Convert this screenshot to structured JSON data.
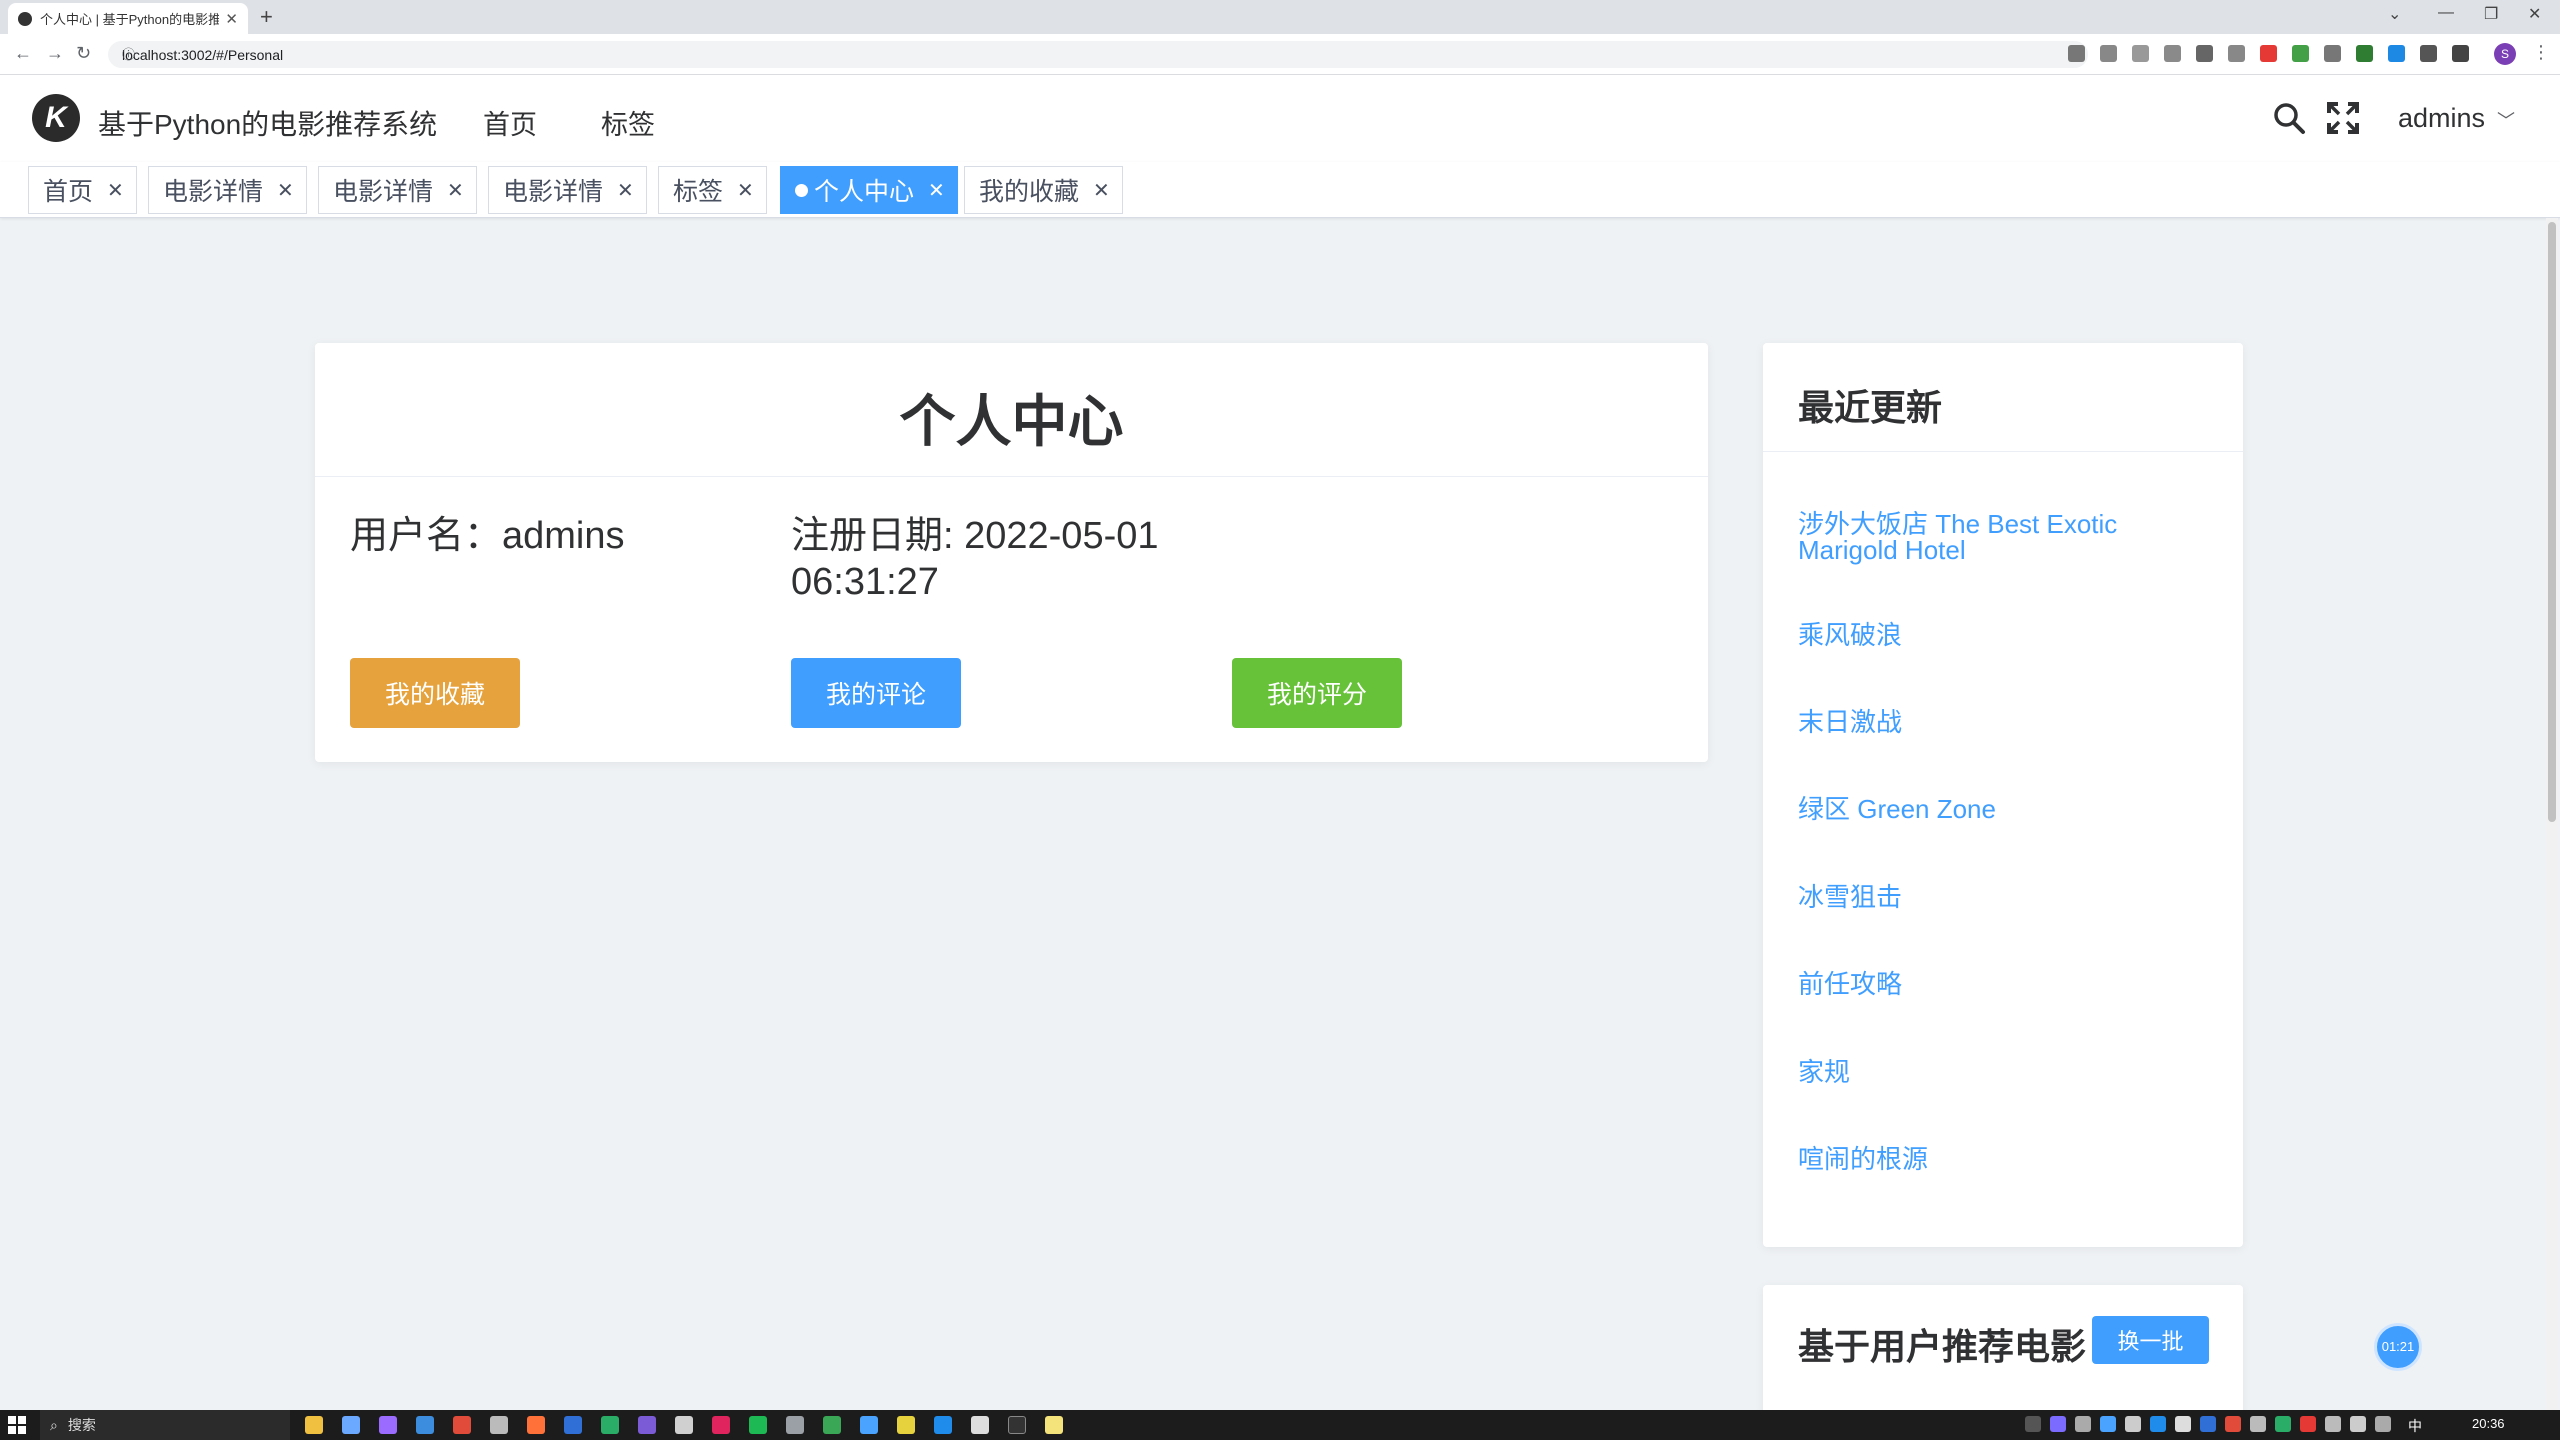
{
  "browser": {
    "tab_title": "个人中心 | 基于Python的电影推荐系",
    "tab_close": "✕",
    "new_tab": "+",
    "url": "localhost:3002/#/Personal",
    "profile_initial": "S"
  },
  "header": {
    "app_title": "基于Python的电影推荐系统",
    "nav": [
      "首页",
      "标签"
    ],
    "user": "admins"
  },
  "tags": [
    {
      "label": "首页",
      "active": false
    },
    {
      "label": "电影详情",
      "active": false
    },
    {
      "label": "电影详情",
      "active": false
    },
    {
      "label": "电影详情",
      "active": false
    },
    {
      "label": "标签",
      "active": false
    },
    {
      "label": "个人中心",
      "active": true
    },
    {
      "label": "我的收藏",
      "active": false
    }
  ],
  "tag_close": "✕",
  "profile": {
    "title": "个人中心",
    "username_line": "用户名：admins",
    "register_line1": "注册日期: 2022-05-01",
    "register_line2": "06:31:27",
    "buttons": {
      "favorites": "我的收藏",
      "comments": "我的评论",
      "ratings": "我的评分"
    }
  },
  "recent": {
    "title": "最近更新",
    "movies": [
      "涉外大饭店 The Best Exotic Marigold Hotel",
      "乘风破浪",
      "末日激战",
      "绿区 Green Zone",
      "冰雪狙击",
      "前任攻略",
      "家规",
      "喧闹的根源"
    ]
  },
  "recommend": {
    "title": "基于用户推荐电影",
    "refresh": "换一批"
  },
  "timer": "01:21",
  "taskbar": {
    "search": "搜索",
    "lang": "中",
    "time": "20:36"
  },
  "colors": {
    "accent": "#409eff",
    "favorites_btn": "#e6a23c",
    "ratings_btn": "#67c23a"
  }
}
